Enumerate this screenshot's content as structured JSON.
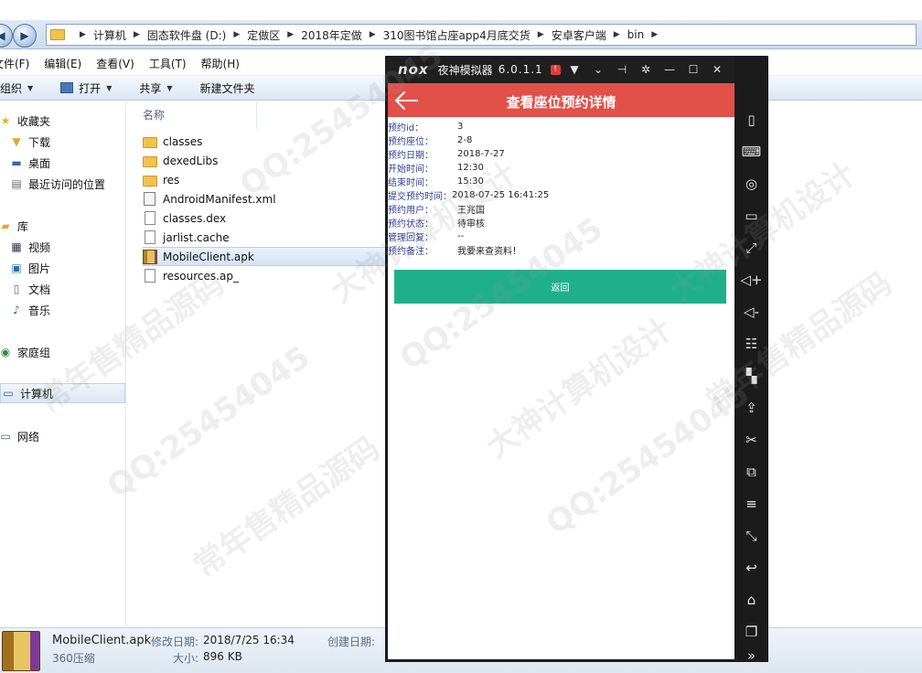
{
  "explorer": {
    "breadcrumb": [
      "计算机",
      "固态软件盘 (D:)",
      "定做区",
      "2018年定做",
      "310图书馆占座app4月底交货",
      "安卓客户端",
      "bin"
    ],
    "menu": [
      "文件(F)",
      "编辑(E)",
      "查看(V)",
      "工具(T)",
      "帮助(H)"
    ],
    "toolbar": {
      "organize": "组织",
      "open": "打开",
      "share": "共享",
      "new_folder": "新建文件夹"
    },
    "sidebar": {
      "favorites": "收藏夹",
      "downloads": "下载",
      "desktop": "桌面",
      "recent": "最近访问的位置",
      "libraries": "库",
      "videos": "视频",
      "pictures": "图片",
      "documents": "文档",
      "music": "音乐",
      "homegroup": "家庭组",
      "computer": "计算机",
      "network": "网络"
    },
    "column_name": "名称",
    "files": [
      {
        "name": "classes",
        "type": "folder"
      },
      {
        "name": "dexedLibs",
        "type": "folder"
      },
      {
        "name": "res",
        "type": "folder"
      },
      {
        "name": "AndroidManifest.xml",
        "type": "xml"
      },
      {
        "name": "classes.dex",
        "type": "doc"
      },
      {
        "name": "jarlist.cache",
        "type": "doc"
      },
      {
        "name": "MobileClient.apk",
        "type": "apk",
        "selected": true
      },
      {
        "name": "resources.ap_",
        "type": "doc"
      }
    ],
    "status": {
      "filename": "MobileClient.apk",
      "modified_label": "修改日期:",
      "modified_value": "2018/7/25 16:34",
      "created_label": "创建日期:",
      "app_type": "360压缩",
      "size_label": "大小:",
      "size_value": "896 KB"
    }
  },
  "emulator": {
    "logo": "nox",
    "name": "夜神模拟器",
    "version": "6.0.1.1",
    "badge": "!",
    "app": {
      "title": "查看座位预约详情",
      "details": [
        {
          "label": "预约id：",
          "value": "3"
        },
        {
          "label": "预约座位：",
          "value": "2-8"
        },
        {
          "label": "预约日期：",
          "value": "2018-7-27"
        },
        {
          "label": "开始时间：",
          "value": "12:30"
        },
        {
          "label": "结束时间：",
          "value": "15:30"
        },
        {
          "label": "提交预约时间：",
          "value": "2018-07-25 16:41:25"
        },
        {
          "label": "预约用户：",
          "value": "王兆国"
        },
        {
          "label": "预约状态：",
          "value": "待审核"
        },
        {
          "label": "管理回复：",
          "value": "--"
        },
        {
          "label": "预约备注：",
          "value": "我要来查资料！"
        }
      ],
      "return_button": "返回"
    }
  },
  "watermark": [
    "QQ:25454045",
    "大神计算机设计",
    "常年售精品源码",
    "QQ:25454045",
    "大神计算机设计",
    "常年售精品源码",
    "QQ:25454045",
    "QQ:25454045",
    "大神计算机设计",
    "常年售精品源码"
  ],
  "colors": {
    "app_header": "#e2504a",
    "return_button": "#1fb08a",
    "detail_label": "#2b3f8e",
    "emulator_frame": "#1b1b1b"
  }
}
